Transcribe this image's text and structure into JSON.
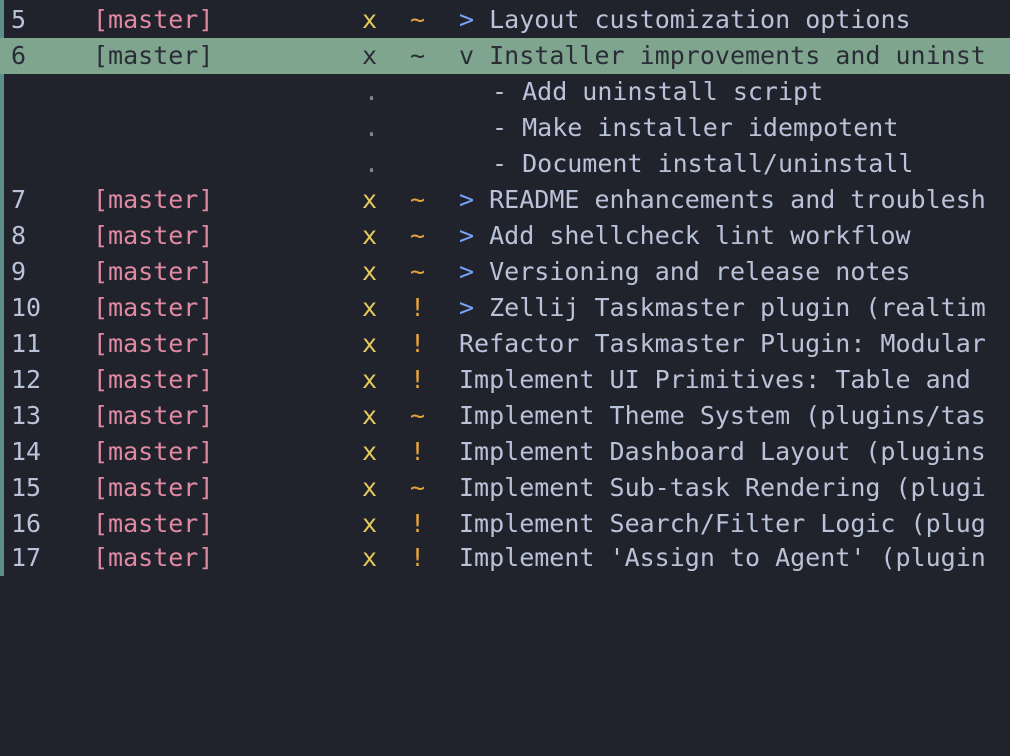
{
  "rows": [
    {
      "id": "5",
      "branch": "[master]",
      "status": "x",
      "priority": "~",
      "chevron": ">",
      "title": "Layout customization options"
    },
    {
      "id": "6",
      "branch": "[master]",
      "status": "x",
      "priority": "~",
      "chevron": "v",
      "title": "Installer improvements and uninst"
    },
    {
      "id": "7",
      "branch": "[master]",
      "status": "x",
      "priority": "~",
      "chevron": ">",
      "title": "README enhancements and troublesh"
    },
    {
      "id": "8",
      "branch": "[master]",
      "status": "x",
      "priority": "~",
      "chevron": ">",
      "title": "Add shellcheck lint workflow"
    },
    {
      "id": "9",
      "branch": "[master]",
      "status": "x",
      "priority": "~",
      "chevron": ">",
      "title": "Versioning and release notes"
    },
    {
      "id": "10",
      "branch": "[master]",
      "status": "x",
      "priority": "!",
      "chevron": ">",
      "title": "Zellij Taskmaster plugin (realtim"
    },
    {
      "id": "11",
      "branch": "[master]",
      "status": "x",
      "priority": "!",
      "title": "Refactor Taskmaster Plugin: Modular"
    },
    {
      "id": "12",
      "branch": "[master]",
      "status": "x",
      "priority": "!",
      "title": "Implement UI Primitives: Table and"
    },
    {
      "id": "13",
      "branch": "[master]",
      "status": "x",
      "priority": "~",
      "title": "Implement Theme System (plugins/tas"
    },
    {
      "id": "14",
      "branch": "[master]",
      "status": "x",
      "priority": "!",
      "title": "Implement Dashboard Layout (plugins"
    },
    {
      "id": "15",
      "branch": "[master]",
      "status": "x",
      "priority": "~",
      "title": "Implement Sub-task Rendering (plugi"
    },
    {
      "id": "16",
      "branch": "[master]",
      "status": "x",
      "priority": "!",
      "title": "Implement Search/Filter Logic (plug"
    },
    {
      "id": "17",
      "branch": "[master]",
      "status": "x",
      "priority": "!",
      "title": "Implement 'Assign to Agent' (plugin"
    }
  ],
  "subtasks": [
    {
      "marker": ".",
      "text": "- Add uninstall script"
    },
    {
      "marker": ".",
      "text": "- Make installer idempotent"
    },
    {
      "marker": ".",
      "text": "- Document install/uninstall"
    }
  ]
}
